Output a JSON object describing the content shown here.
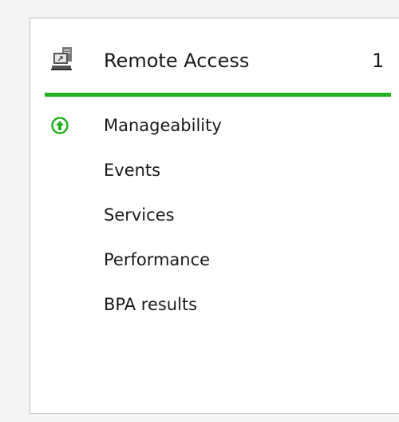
{
  "tile": {
    "title": "Remote Access",
    "count": "1",
    "icon": "server-icon",
    "status_color": "#22b222"
  },
  "items": [
    {
      "label": "Manageability",
      "icon": "upgrade-arrow-icon"
    },
    {
      "label": "Events"
    },
    {
      "label": "Services"
    },
    {
      "label": "Performance"
    },
    {
      "label": "BPA results"
    }
  ]
}
